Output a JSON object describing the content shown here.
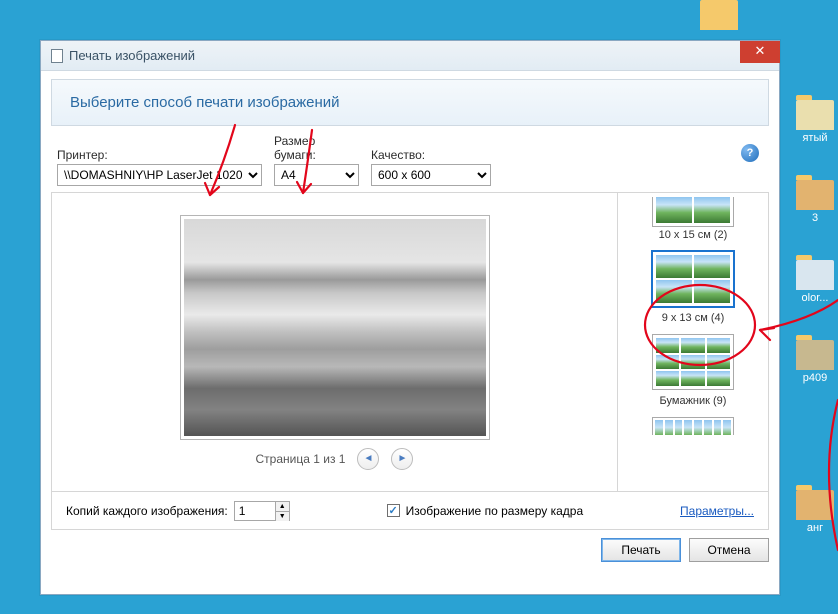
{
  "desktop": {
    "icons": [
      {
        "label": ""
      },
      {
        "label": "ятый"
      },
      {
        "label": "3"
      },
      {
        "label": "olor..."
      },
      {
        "label": "p409"
      },
      {
        "label": "анг"
      }
    ]
  },
  "window": {
    "title": "Печать изображений"
  },
  "banner": "Выберите способ печати изображений",
  "printer": {
    "label": "Принтер:",
    "value": "\\\\DOMASHNIY\\HP LaserJet 1020"
  },
  "paper": {
    "label": "Размер бумаги:",
    "value": "A4"
  },
  "quality": {
    "label": "Качество:",
    "value": "600 x 600"
  },
  "pager": {
    "text": "Страница 1 из 1"
  },
  "layouts": [
    {
      "label": "10 x 15 см (2)"
    },
    {
      "label": "9 x 13 см (4)"
    },
    {
      "label": "Бумажник (9)"
    }
  ],
  "footer": {
    "copies_label": "Копий каждого изображения:",
    "copies_value": "1",
    "fit_label": "Изображение по размеру кадра",
    "fit_checked": true,
    "options_link": "Параметры..."
  },
  "buttons": {
    "print": "Печать",
    "cancel": "Отмена"
  }
}
